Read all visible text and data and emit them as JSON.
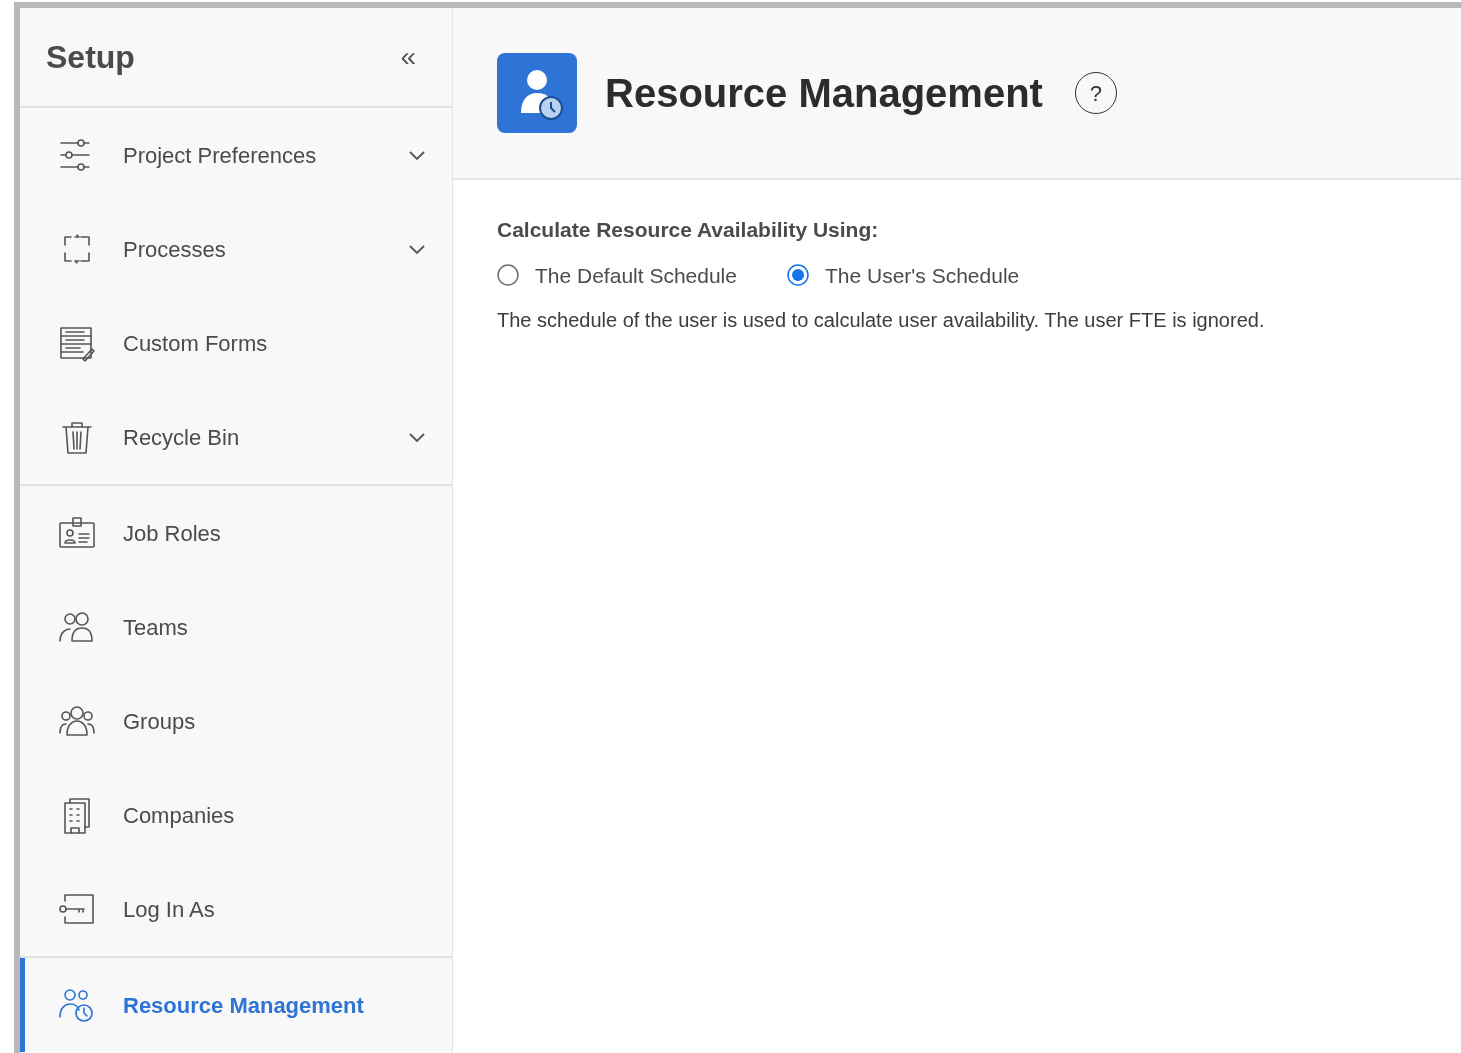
{
  "sidebar": {
    "title": "Setup",
    "collapse_glyph": "«",
    "sections": [
      {
        "items": [
          {
            "label": "Project Preferences",
            "expandable": true,
            "selected": false
          },
          {
            "label": "Processes",
            "expandable": true,
            "selected": false
          },
          {
            "label": "Custom Forms",
            "expandable": false,
            "selected": false
          },
          {
            "label": "Recycle Bin",
            "expandable": true,
            "selected": false
          }
        ]
      },
      {
        "items": [
          {
            "label": "Job Roles",
            "expandable": false,
            "selected": false
          },
          {
            "label": "Teams",
            "expandable": false,
            "selected": false
          },
          {
            "label": "Groups",
            "expandable": false,
            "selected": false
          },
          {
            "label": "Companies",
            "expandable": false,
            "selected": false
          },
          {
            "label": "Log In As",
            "expandable": false,
            "selected": false
          }
        ]
      },
      {
        "items": [
          {
            "label": "Resource Management",
            "expandable": false,
            "selected": true
          }
        ]
      }
    ]
  },
  "header": {
    "title": "Resource Management",
    "help_glyph": "?"
  },
  "setting": {
    "label": "Calculate Resource Availability Using:",
    "options": [
      {
        "label": "The Default Schedule",
        "selected": false
      },
      {
        "label": "The User's Schedule",
        "selected": true
      }
    ],
    "description": "The schedule of the user is used to calculate user availability. The user FTE is ignored."
  }
}
